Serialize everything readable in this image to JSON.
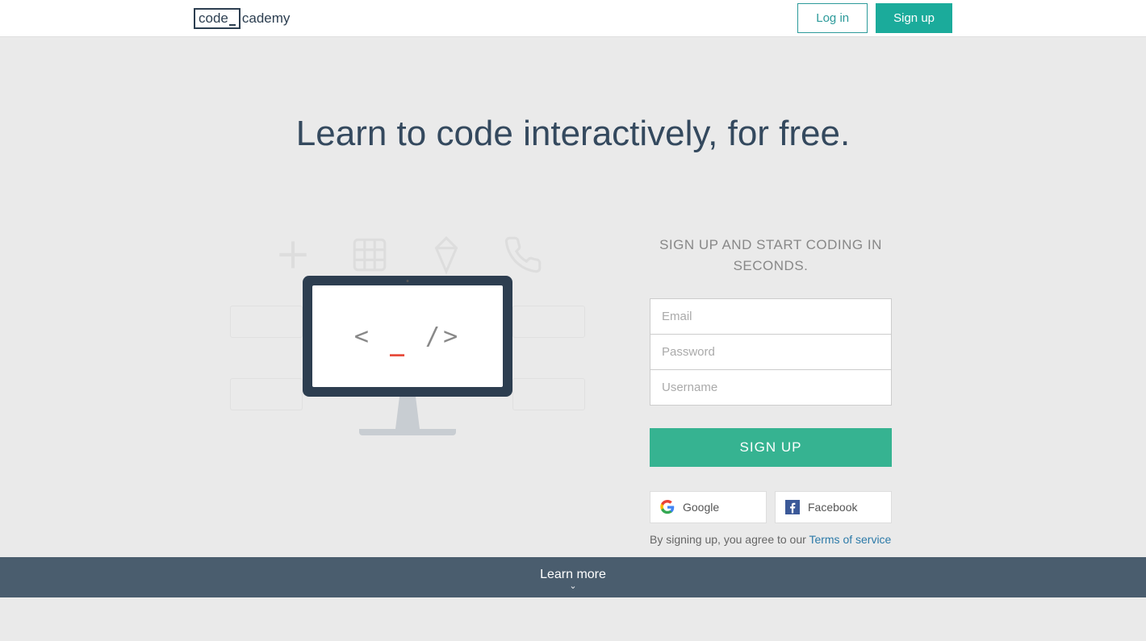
{
  "header": {
    "logo_part1": "code",
    "logo_part2": "cademy",
    "login_label": "Log in",
    "signup_label": "Sign up"
  },
  "hero": {
    "title": "Learn to code interactively, for free."
  },
  "signup": {
    "heading": "SIGN UP AND START CODING IN SECONDS.",
    "email_placeholder": "Email",
    "password_placeholder": "Password",
    "username_placeholder": "Username",
    "submit_label": "SIGN UP",
    "google_label": "Google",
    "facebook_label": "Facebook",
    "terms_prefix": "By signing up, you agree to our ",
    "terms_link": "Terms of service"
  },
  "footer": {
    "learn_more": "Learn more"
  }
}
